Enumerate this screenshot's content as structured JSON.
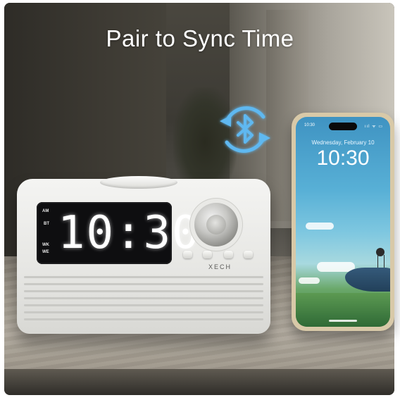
{
  "headline": "Pair to Sync Time",
  "icons": {
    "sync": "bluetooth-sync-icon",
    "bluetooth": "bluetooth-icon"
  },
  "colors": {
    "bluetooth_accent": "#5fb8f0",
    "clock_body": "#ecece9",
    "display_bg": "#0e0e10"
  },
  "clock": {
    "brand": "XECH",
    "time": "10:30",
    "indicators": {
      "am": "AM",
      "bt": "BT",
      "bottom_a": "WK",
      "bottom_b": "WE"
    }
  },
  "phone": {
    "status_time": "10:30",
    "status_icons": "ııl ᯤ ▭",
    "date": "Wednesday, February 10",
    "time": "10:30"
  }
}
